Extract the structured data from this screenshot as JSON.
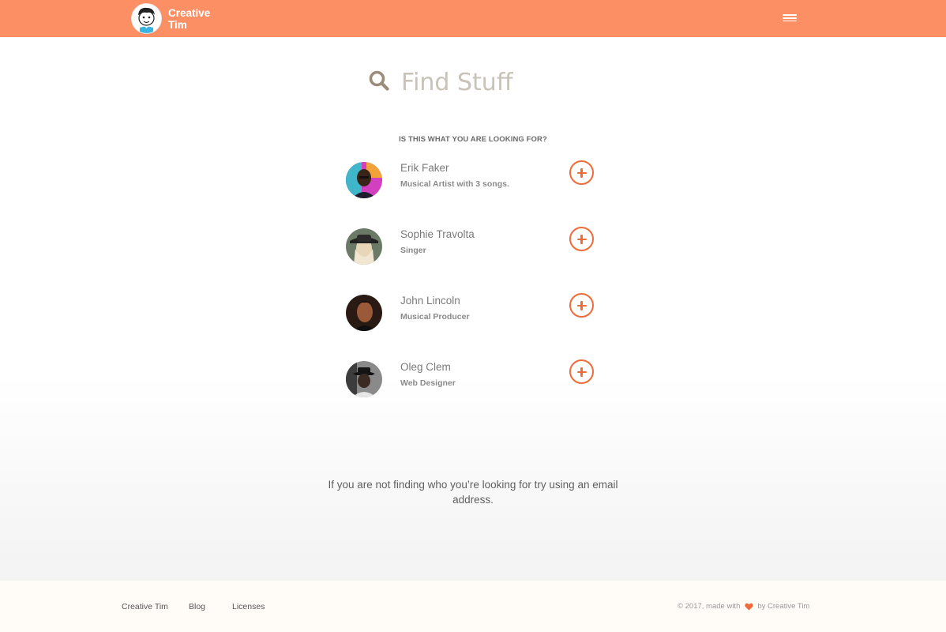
{
  "navbar": {
    "brand_line1": "Creative",
    "brand_line2": "Tim",
    "logo_icon": "creative-tim-logo",
    "menu_icon": "hamburger-menu-icon",
    "background": "#fc9064"
  },
  "search": {
    "placeholder": "Find Stuff",
    "icon": "search-icon"
  },
  "results": {
    "heading": "IS THIS WHAT YOU ARE LOOKING FOR?",
    "people": [
      {
        "name": "Erik Faker",
        "role": "Musical Artist with 3 songs."
      },
      {
        "name": "Sophie Travolta",
        "role": "Singer"
      },
      {
        "name": "John Lincoln",
        "role": "Musical Producer"
      },
      {
        "name": "Oleg Clem",
        "role": "Web Designer"
      }
    ],
    "add_icon": "plus-circle-icon",
    "accent": "#ef6b3a"
  },
  "hint": "If you are not finding who you’re looking for try using an email address.",
  "footer": {
    "links": [
      "Creative Tim",
      "Blog",
      "Licenses"
    ],
    "copyright_prefix": "© 2017, made with",
    "copyright_suffix": "by Creative Tim",
    "heart_icon": "heart-icon"
  }
}
